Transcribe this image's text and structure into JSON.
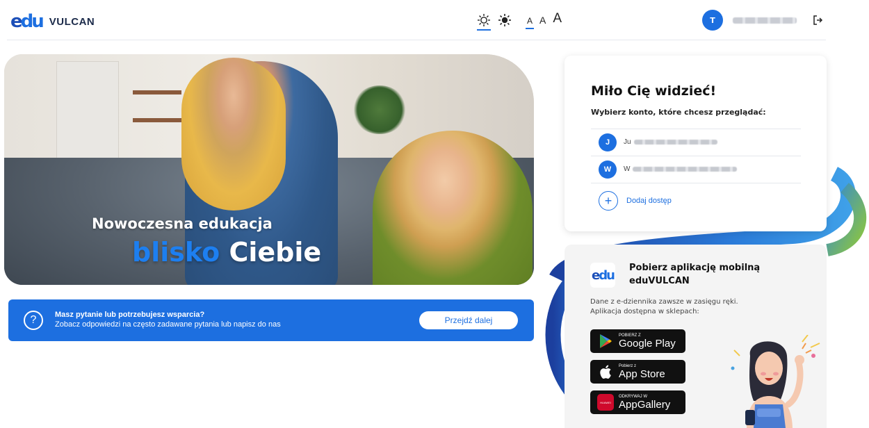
{
  "header": {
    "logo_mark_e": "e",
    "logo_mark_du": "du",
    "brand": "VULCAN",
    "font_sizes": [
      "A",
      "A",
      "A"
    ],
    "user_initial": "T"
  },
  "hero": {
    "title": "Nowoczesna edukacja",
    "subtitle_blue": "blisko",
    "subtitle_white": "Ciebie"
  },
  "help": {
    "icon": "?",
    "question": "Masz pytanie lub potrzebujesz wsparcia?",
    "description": "Zobacz odpowiedzi na często zadawane pytania lub napisz do nas",
    "button": "Przejdź dalej"
  },
  "accounts": {
    "title": "Miło Cię widzieć!",
    "subtitle": "Wybierz konto, które chcesz przeglądać:",
    "items": [
      {
        "initial": "J",
        "name_prefix": "Ju"
      },
      {
        "initial": "W",
        "name_prefix": "W"
      }
    ],
    "add_icon": "+",
    "add_label": "Dodaj dostęp"
  },
  "mobile": {
    "logo_e": "e",
    "logo_du": "du",
    "title": "Pobierz aplikację mobilną eduVULCAN",
    "desc_line1": "Dane z e-dziennika zawsze w zasięgu ręki.",
    "desc_line2": "Aplikacja dostępna w sklepach:",
    "stores": [
      {
        "small": "POBIERZ Z",
        "big": "Google Play"
      },
      {
        "small": "Pobierz z",
        "big": "App Store"
      },
      {
        "small": "ODKRYWAJ W",
        "big": "AppGallery",
        "badge": "HUAWEI"
      }
    ]
  },
  "colors": {
    "primary": "#1d6fe0",
    "dark_blue": "#1c4fb8",
    "green_swirl": "#8cc63f"
  }
}
